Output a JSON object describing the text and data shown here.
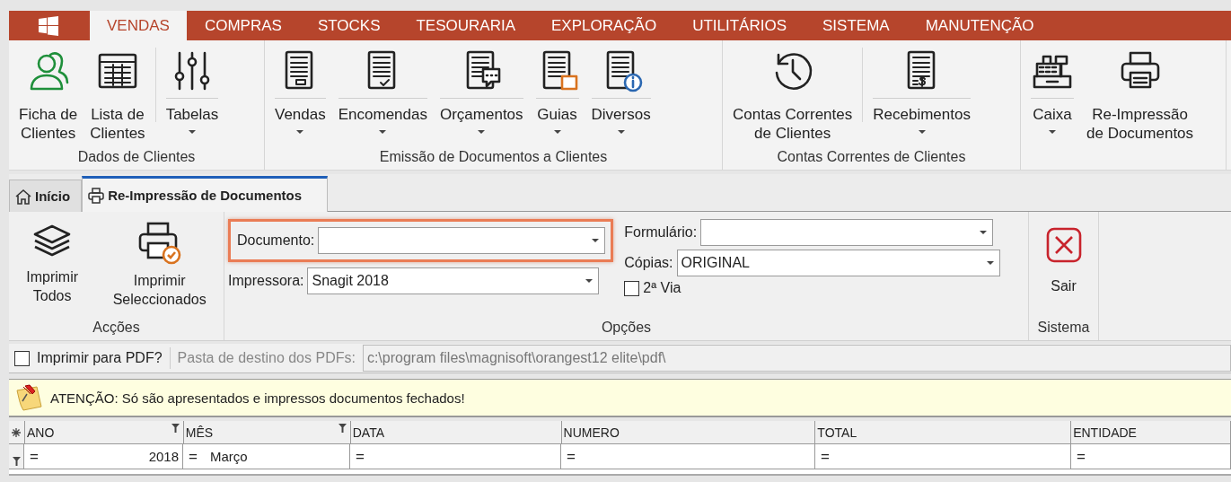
{
  "menu": {
    "tabs": [
      {
        "label": "VENDAS",
        "selected": true
      },
      {
        "label": "COMPRAS",
        "selected": false
      },
      {
        "label": "STOCKS",
        "selected": false
      },
      {
        "label": "TESOURARIA",
        "selected": false
      },
      {
        "label": "EXPLORAÇÃO",
        "selected": false
      },
      {
        "label": "UTILITÁRIOS",
        "selected": false
      },
      {
        "label": "SISTEMA",
        "selected": false
      },
      {
        "label": "MANUTENÇÃO",
        "selected": false
      }
    ]
  },
  "ribbon": {
    "groups": [
      {
        "label": "Dados de Clientes",
        "items": [
          {
            "label": [
              "Ficha de",
              "Clientes"
            ],
            "dropdown": false,
            "divider_before": false
          },
          {
            "label": [
              "Lista de",
              "Clientes"
            ],
            "dropdown": false,
            "divider_before": false
          },
          {
            "label": [
              "Tabelas"
            ],
            "dropdown": true,
            "divider_before": true
          }
        ]
      },
      {
        "label": "Emissão de Documentos a Clientes",
        "items": [
          {
            "label": [
              "Vendas"
            ],
            "dropdown": true,
            "divider_before": false
          },
          {
            "label": [
              "Encomendas"
            ],
            "dropdown": true,
            "divider_before": false
          },
          {
            "label": [
              "Orçamentos"
            ],
            "dropdown": true,
            "divider_before": false
          },
          {
            "label": [
              "Guias"
            ],
            "dropdown": true,
            "divider_before": false
          },
          {
            "label": [
              "Diversos"
            ],
            "dropdown": true,
            "divider_before": false
          }
        ]
      },
      {
        "label": "Contas Correntes de Clientes",
        "items": [
          {
            "label": [
              "Contas Correntes",
              "de Clientes"
            ],
            "dropdown": false,
            "divider_before": false
          },
          {
            "label": [
              "Recebimentos"
            ],
            "dropdown": true,
            "divider_before": true
          }
        ]
      },
      {
        "items": [
          {
            "label": [
              "Caixa"
            ],
            "dropdown": true,
            "divider_before": false
          },
          {
            "label": [
              "Re-Impressão",
              "de Documentos"
            ],
            "dropdown": false,
            "divider_before": false
          }
        ]
      }
    ]
  },
  "doc_tabs": [
    {
      "label": "Início",
      "selected": false
    },
    {
      "label": "Re-Impressão de Documentos",
      "selected": true
    }
  ],
  "options": {
    "accoes": {
      "label": "Acções",
      "buttons": [
        [
          "Imprimir",
          "Todos"
        ],
        [
          "Imprimir",
          "Seleccionados"
        ]
      ]
    },
    "opcoes": {
      "label": "Opções",
      "documento": {
        "label": "Documento:",
        "highlighted": true
      },
      "impressora": {
        "label": "Impressora:",
        "value": "Snagit 2018"
      },
      "formulario": {
        "label": "Formulário:"
      },
      "copias": {
        "label": "Cópias:",
        "value": "ORIGINAL"
      },
      "segunda_via": {
        "label": "2ª Via",
        "checked": false
      }
    },
    "sistema": {
      "label": "Sistema",
      "button": "Sair"
    }
  },
  "pdf": {
    "checkbox": {
      "label": "Imprimir para PDF?",
      "checked": false
    },
    "folder": {
      "label": "Pasta de destino dos PDFs:",
      "value": "c:\\program files\\magnisoft\\orangest12 elite\\pdf\\",
      "disabled": true
    }
  },
  "notice": {
    "text": "ATENÇÃO: Só são apresentados e impressos documentos fechados!"
  },
  "grid": {
    "columns": [
      {
        "label": "ANO",
        "filter": true,
        "right_aligned": true
      },
      {
        "label": "MÊS",
        "filter": true,
        "right_aligned": false
      },
      {
        "label": "DATA",
        "filter": false
      },
      {
        "label": "NUMERO",
        "filter": false
      },
      {
        "label": "TOTAL",
        "filter": false
      },
      {
        "label": "ENTIDADE",
        "filter": false
      }
    ],
    "filter_row": [
      {
        "operator": "=",
        "value": "2018"
      },
      {
        "operator": "=",
        "value": "Março"
      },
      {
        "operator": "="
      },
      {
        "operator": "="
      },
      {
        "operator": "="
      },
      {
        "operator": "="
      }
    ]
  }
}
